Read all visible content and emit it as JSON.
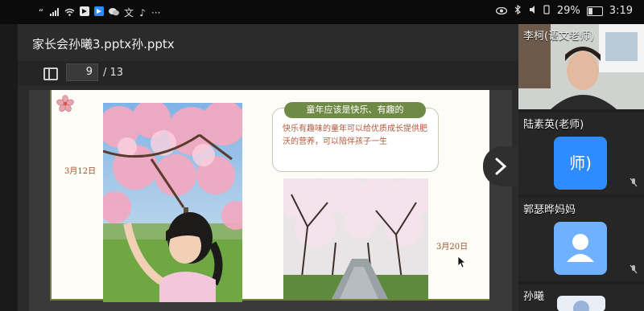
{
  "status_bar": {
    "left_icons": [
      "“",
      "signal-icon",
      "wifi-icon",
      "video-app-icon",
      "video-app-icon",
      "wechat-icon",
      "translate-icon",
      "music-icon",
      "more-icon"
    ],
    "battery": "29%",
    "time": "3:19"
  },
  "document": {
    "title": "家长会孙曦3.pptx孙.pptx",
    "current_page": "9",
    "total_pages": "/ 13"
  },
  "slide": {
    "date_left": "3月12日",
    "card_title": "童年应该是快乐、有趣的",
    "card_body": "快乐有趣味的童年可以给优质成长提供肥沃的营养，可以陪伴孩子一生",
    "date_right": "3月20日"
  },
  "participants": [
    {
      "name": "李柯(语文老师)",
      "type": "video"
    },
    {
      "name": "陆素英(老师)",
      "avatar_text": "师)",
      "type": "avatar"
    },
    {
      "name": "郭瑟晔妈妈",
      "type": "avatar-user"
    },
    {
      "name": "孙曦",
      "type": "avatar-image"
    }
  ],
  "colors": {
    "accent_green": "#6f8a45",
    "avatar_blue": "#2d8cff",
    "avatar_light_blue": "#6fb0ff",
    "date_text": "#a0522d"
  }
}
